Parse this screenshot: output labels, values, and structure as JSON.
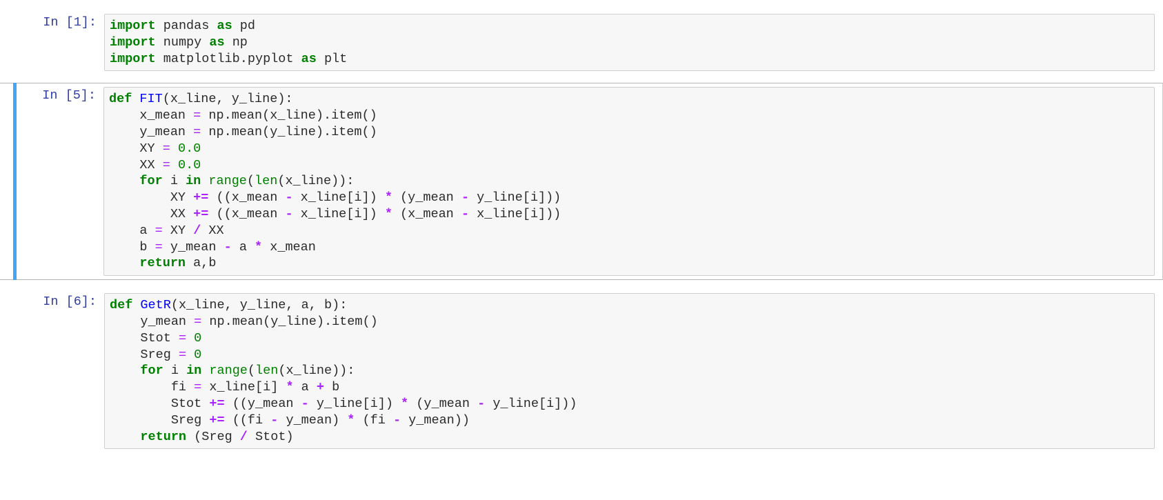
{
  "notebook": {
    "kernel_language": "python",
    "colors": {
      "selected_cell_bar": "#42a5f5",
      "code_background": "#f7f7f7",
      "code_border": "#cfcfcf",
      "prompt_text": "#303f9f",
      "keyword": "#008000",
      "builtin": "#008000",
      "function_name": "#0000ff",
      "number": "#008000",
      "operator": "#aa22ff",
      "plain_text": "#2b2b2b"
    },
    "cells": [
      {
        "id": "cell-1",
        "prompt": "In [1]:",
        "execution_count": 1,
        "selected": false,
        "source": "import pandas as pd\nimport numpy as np\nimport matplotlib.pyplot as plt",
        "lines": [
          "import pandas as pd",
          "import numpy as np",
          "import matplotlib.pyplot as plt"
        ]
      },
      {
        "id": "cell-2",
        "prompt": "In [5]:",
        "execution_count": 5,
        "selected": true,
        "source": "def FIT(x_line, y_line):\n    x_mean = np.mean(x_line).item()\n    y_mean = np.mean(y_line).item()\n    XY = 0.0\n    XX = 0.0\n    for i in range(len(x_line)):\n        XY += ((x_mean - x_line[i]) * (y_mean - y_line[i]))\n        XX += ((x_mean - x_line[i]) * (x_mean - x_line[i]))\n    a = XY / XX\n    b = y_mean - a * x_mean\n    return a,b",
        "lines": [
          "def FIT(x_line, y_line):",
          "    x_mean = np.mean(x_line).item()",
          "    y_mean = np.mean(y_line).item()",
          "    XY = 0.0",
          "    XX = 0.0",
          "    for i in range(len(x_line)):",
          "        XY += ((x_mean - x_line[i]) * (y_mean - y_line[i]))",
          "        XX += ((x_mean - x_line[i]) * (x_mean - x_line[i]))",
          "    a = XY / XX",
          "    b = y_mean - a * x_mean",
          "    return a,b"
        ]
      },
      {
        "id": "cell-3",
        "prompt": "In [6]:",
        "execution_count": 6,
        "selected": false,
        "source": "def GetR(x_line, y_line, a, b):\n    y_mean = np.mean(y_line).item()\n    Stot = 0\n    Sreg = 0\n    for i in range(len(x_line)):\n        fi = x_line[i] * a + b\n        Stot += ((y_mean - y_line[i]) * (y_mean - y_line[i]))\n        Sreg += ((fi - y_mean) * (fi - y_mean))\n    return (Sreg / Stot)",
        "lines": [
          "def GetR(x_line, y_line, a, b):",
          "    y_mean = np.mean(y_line).item()",
          "    Stot = 0",
          "    Sreg = 0",
          "    for i in range(len(x_line)):",
          "        fi = x_line[i] * a + b",
          "        Stot += ((y_mean - y_line[i]) * (y_mean - y_line[i]))",
          "        Sreg += ((fi - y_mean) * (fi - y_mean))",
          "    return (Sreg / Stot)"
        ]
      }
    ]
  }
}
